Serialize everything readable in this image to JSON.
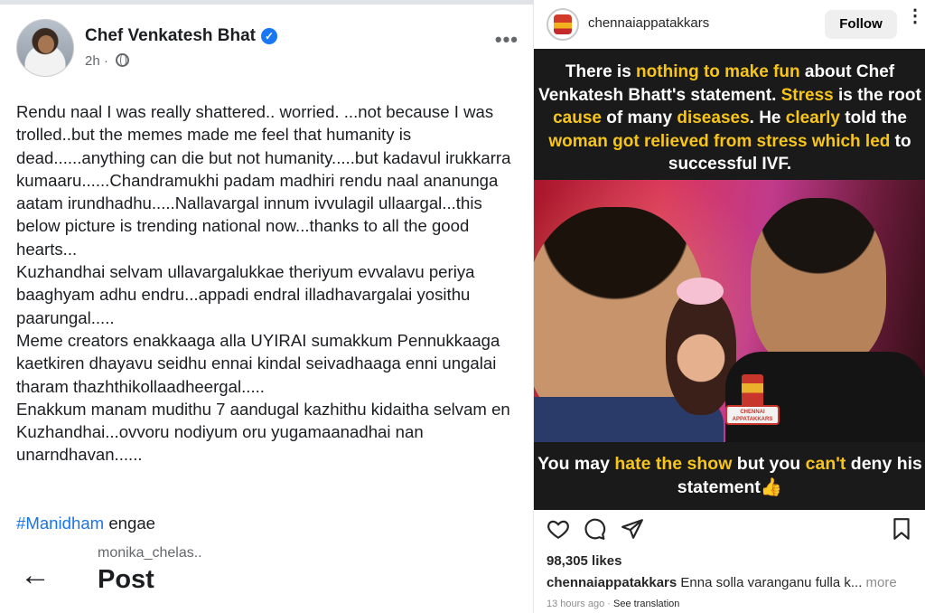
{
  "facebook": {
    "author": "Chef Venkatesh Bhat",
    "verified_icon": "check",
    "timestamp": "2h",
    "audience_icon": "globe-icon",
    "more_icon": "•••",
    "paragraphs": [
      "Rendu naal I was really shattered.. worried. ...not because I was trolled..but the memes made me feel that humanity is dead......anything can die but not humanity.....but kadavul irukkarra kumaaru......Chandramukhi padam madhiri rendu naal ananunga aatam irundhadhu.....Nallavargal innum ivvulagil ullaargal...this below picture is trending national now...thanks to all the good hearts...",
      "Kuzhandhai selvam ullavargalukkae theriyum evvalavu periya baaghyam adhu endru...appadi endral illadhavargalai yosithu paarungal.....",
      "Meme creators enakkaaga alla UYIRAI sumakkum Pennukkaaga  kaetkiren dhayavu seidhu ennai kindal seivadhaaga enni ungalai tharam thazhthikollaadheergal.....",
      "Enakkum manam mudithu 7 aandugal kazhithu kidaitha selvam en Kuzhandhai...ovvoru nodiyum oru yugamaanadhai nan unarndhavan......"
    ],
    "hashtag": "#Manidham",
    "hashtag_suffix": " engae",
    "back_icon": "←",
    "sub_user": "monika_chelas..",
    "sub_title": "Post"
  },
  "instagram": {
    "handle": "chennaiappatakkars",
    "follow_label": "Follow",
    "more_icon": "⋮",
    "top_text": [
      {
        "t": "There is ",
        "y": false
      },
      {
        "t": "nothing to make fun",
        "y": true
      },
      {
        "t": " about Chef Venkatesh Bhatt's statement. ",
        "y": false
      },
      {
        "t": "Stress",
        "y": true
      },
      {
        "t": " is the root ",
        "y": false
      },
      {
        "t": "cause",
        "y": true
      },
      {
        "t": " of many ",
        "y": false
      },
      {
        "t": "diseases",
        "y": true
      },
      {
        "t": ". He ",
        "y": false
      },
      {
        "t": "clearly",
        "y": true
      },
      {
        "t": " told the ",
        "y": false
      },
      {
        "t": "woman got relieved from stress which led",
        "y": true
      },
      {
        "t": " to successful IVF.",
        "y": false
      }
    ],
    "badge_text": "CHENNAI APPATAKKARS",
    "bottom_text": [
      {
        "t": "You may ",
        "y": false
      },
      {
        "t": "hate the show",
        "y": true
      },
      {
        "t": " but you ",
        "y": false
      },
      {
        "t": "can't",
        "y": true
      },
      {
        "t": " deny his statement",
        "y": false
      }
    ],
    "thumb_icon": "👍",
    "likes": "98,305 likes",
    "caption_user": "chennaiappatakkars",
    "caption_text": " Enna solla varanganu fulla k...",
    "caption_more": " more",
    "time": "13 hours ago",
    "translate": "See translation",
    "colors": {
      "highlight": "#f7c51a",
      "post_bg": "#1a1a1a",
      "link": "#1b74e4"
    }
  }
}
